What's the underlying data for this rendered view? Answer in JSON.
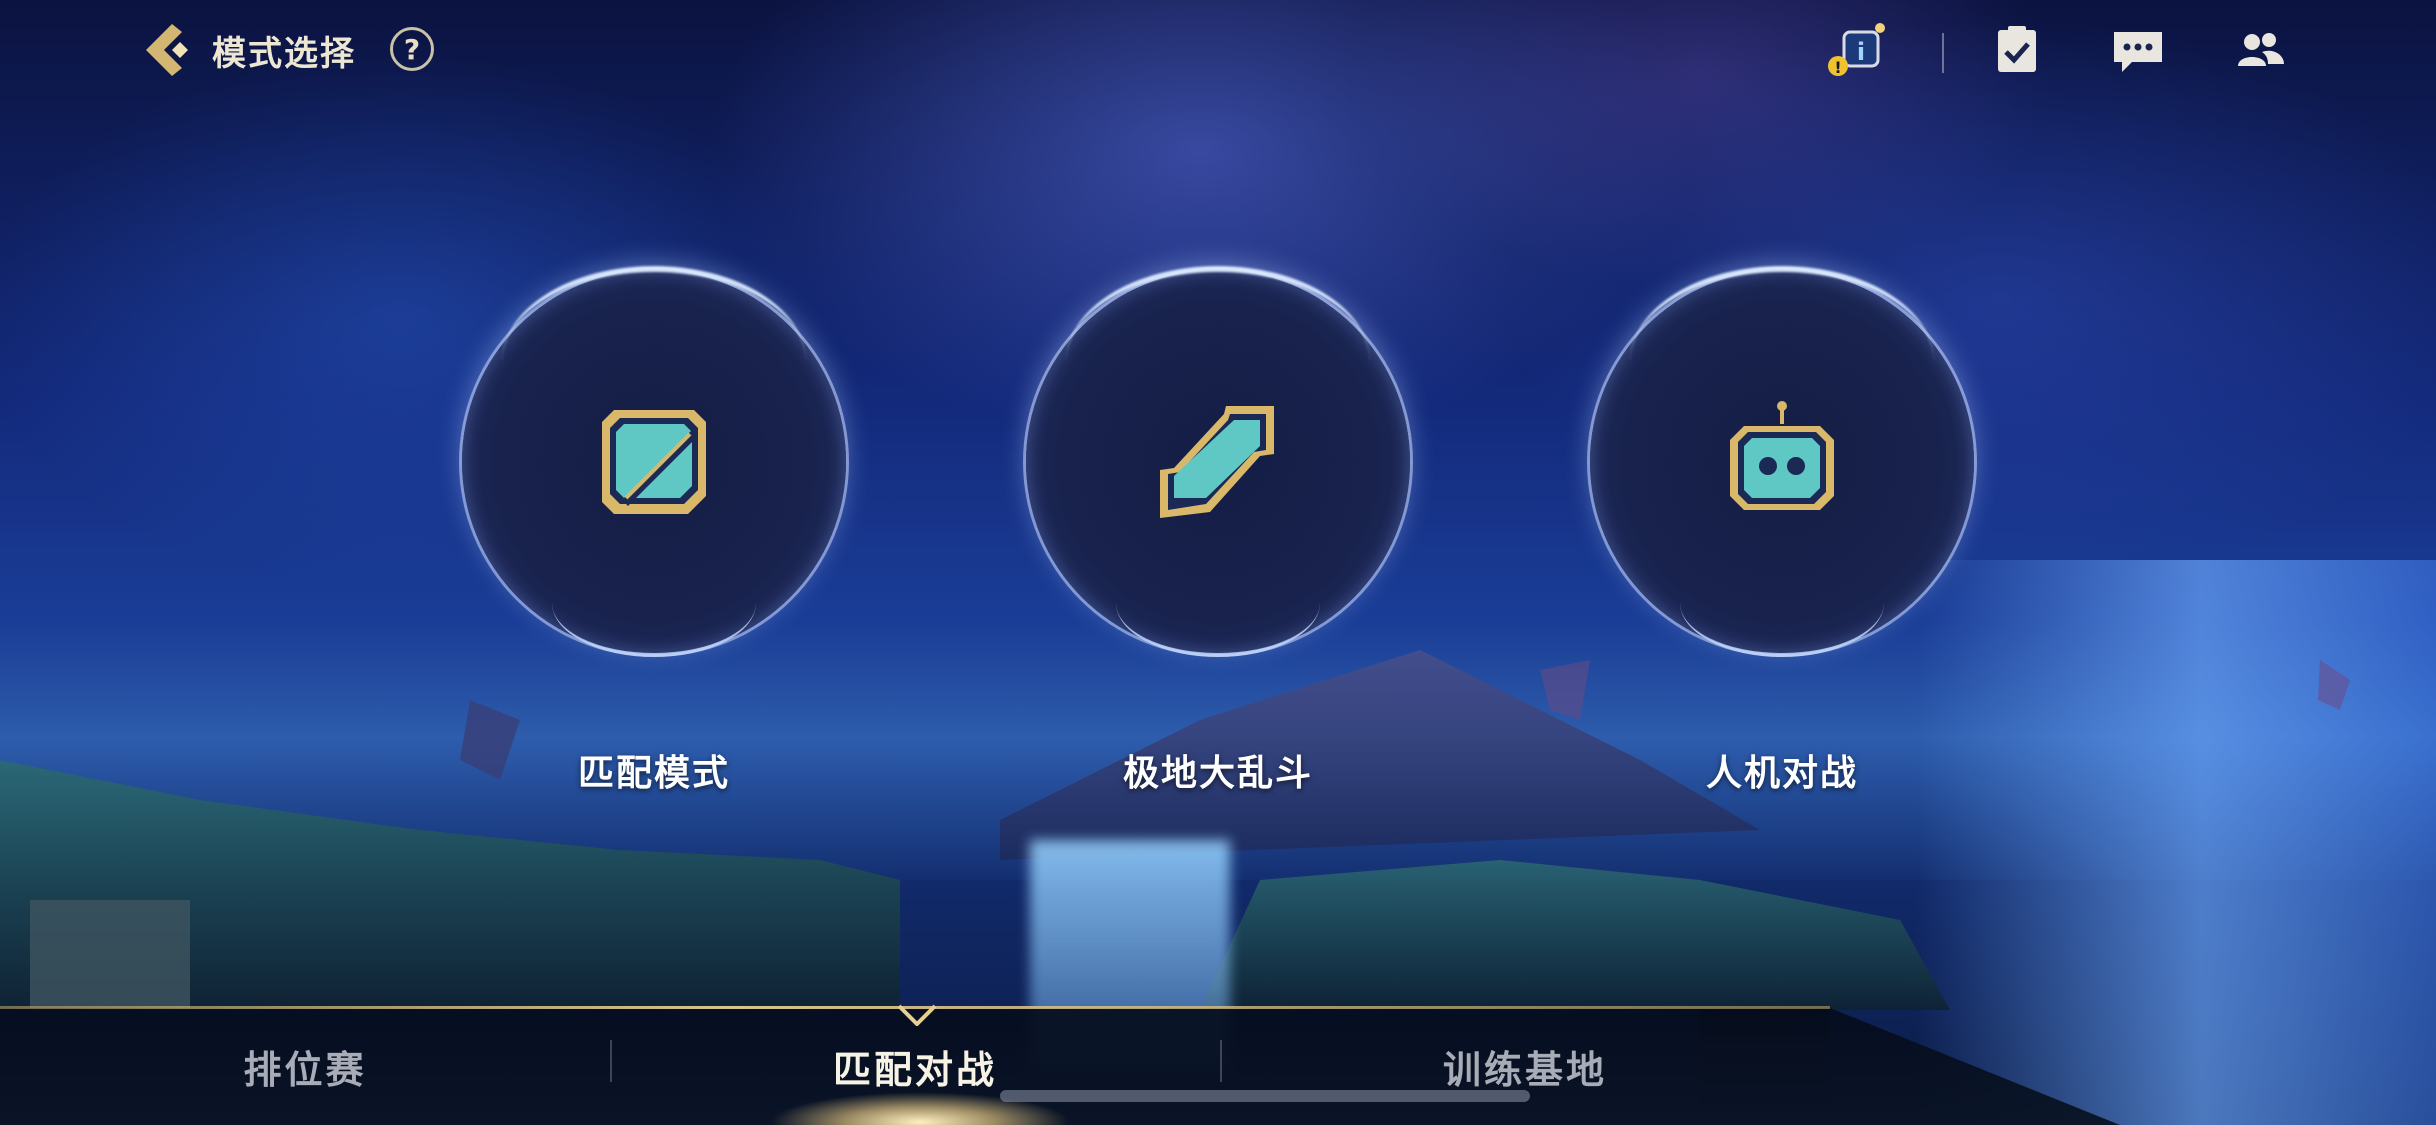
{
  "header": {
    "title": "模式选择",
    "help_label": "?"
  },
  "top_icons": [
    "info-notice-icon",
    "checklist-icon",
    "chat-icon",
    "friends-icon"
  ],
  "modes": [
    {
      "label": "匹配模式",
      "icon": "match-mode-icon"
    },
    {
      "label": "极地大乱斗",
      "icon": "aram-mode-icon"
    },
    {
      "label": "人机对战",
      "icon": "bot-mode-icon"
    }
  ],
  "tabs": [
    {
      "label": "排位赛",
      "active": false
    },
    {
      "label": "匹配对战",
      "active": true
    },
    {
      "label": "训练基地",
      "active": false
    }
  ],
  "colors": {
    "gold": "#d9b86a",
    "teal": "#5fc8c4",
    "active_tab_text": "#f6f2e4",
    "inactive_tab_text": "#a8acb6"
  }
}
